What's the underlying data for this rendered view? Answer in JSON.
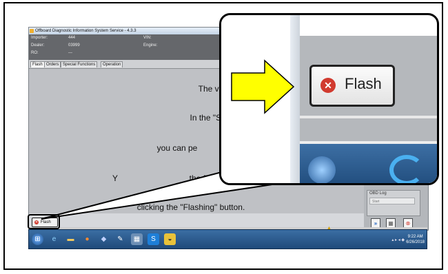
{
  "window": {
    "title": "Offboard Diagnostic Information System Service - 4.3.3",
    "info": {
      "importer_label": "Importer:",
      "importer_value": "444",
      "dealer_label": "Dealer:",
      "dealer_value": "03999",
      "ro_label": "RO:",
      "ro_value": "---",
      "vin_label": "VIN:",
      "engine_label": "Engine:"
    },
    "tabs": [
      "Flash",
      "Orders",
      "Special Functions",
      "Operation"
    ]
  },
  "content": {
    "lines": [
      "The vehicle was id",
      "In the \"Special func",
      "you can pe",
      "Y",
      "the flash s",
      "clicking the \"Flashing\" button."
    ],
    "flash_button_small": "Flash"
  },
  "right_panel": {
    "obd_log_label": "OBD Log",
    "obd_field_text": "Start"
  },
  "zoom_callout": {
    "flash_button_label": "Flash",
    "arrow_color": "#ffff00"
  },
  "taskbar": {
    "clock_time": "9:22 AM",
    "clock_date": "6/26/2018"
  }
}
